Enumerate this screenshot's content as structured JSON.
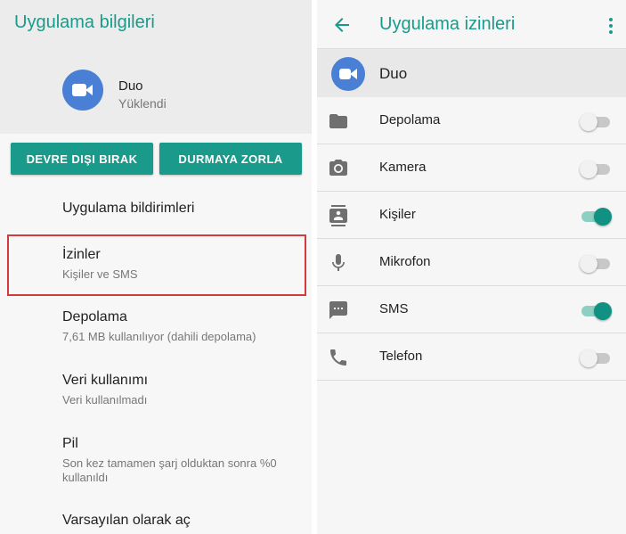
{
  "colors": {
    "accent": "#1a9a8a",
    "highlight": "#d23b3b",
    "app_icon": "#4a7fd6"
  },
  "left": {
    "title": "Uygulama bilgileri",
    "app": {
      "name": "Duo",
      "status": "Yüklendi",
      "icon": "duo-camera-icon"
    },
    "buttons": {
      "disable": "DEVRE DIŞI BIRAK",
      "force_stop": "DURMAYA ZORLA"
    },
    "items": [
      {
        "title": "Uygulama bildirimleri",
        "subtitle": ""
      },
      {
        "title": "İzinler",
        "subtitle": "Kişiler ve SMS"
      },
      {
        "title": "Depolama",
        "subtitle": "7,61 MB kullanılıyor (dahili depolama)"
      },
      {
        "title": "Veri kullanımı",
        "subtitle": "Veri kullanılmadı"
      },
      {
        "title": "Pil",
        "subtitle": "Son kez tamamen şarj olduktan sonra %0 kullanıldı"
      },
      {
        "title": "Varsayılan olarak aç",
        "subtitle": ""
      }
    ]
  },
  "right": {
    "title": "Uygulama izinleri",
    "app_name": "Duo",
    "permissions": [
      {
        "label": "Depolama",
        "icon": "folder-icon",
        "enabled": false
      },
      {
        "label": "Kamera",
        "icon": "camera-icon",
        "enabled": false
      },
      {
        "label": "Kişiler",
        "icon": "contacts-icon",
        "enabled": true
      },
      {
        "label": "Mikrofon",
        "icon": "microphone-icon",
        "enabled": false
      },
      {
        "label": "SMS",
        "icon": "sms-icon",
        "enabled": true
      },
      {
        "label": "Telefon",
        "icon": "phone-icon",
        "enabled": false
      }
    ]
  }
}
